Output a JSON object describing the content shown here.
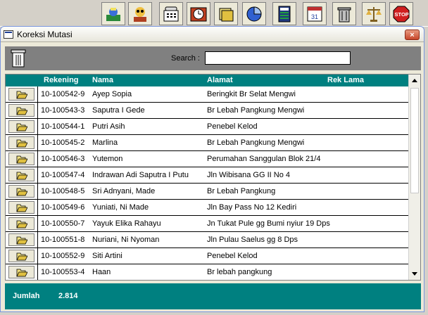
{
  "window": {
    "title": "Koreksi Mutasi",
    "close_label": "×"
  },
  "toolbar": {
    "icons": [
      "mail-icon",
      "cashier-icon",
      "phone-icon",
      "clock-icon",
      "folders-icon",
      "pie-chart-icon",
      "calculator-icon",
      "calendar-icon",
      "trash-icon",
      "scale-icon",
      "stop-icon"
    ],
    "stop_label": "STOP"
  },
  "search": {
    "label": "Search :",
    "value": ""
  },
  "grid": {
    "columns": [
      "Rekening",
      "Nama",
      "Alamat",
      "Rek Lama"
    ],
    "rows": [
      {
        "rekening": "10-100542-9",
        "nama": "Ayep Sopia",
        "alamat": "Beringkit Br Selat Mengwi",
        "rek_lama": ""
      },
      {
        "rekening": "10-100543-3",
        "nama": "Saputra I Gede",
        "alamat": "Br Lebah Pangkung Mengwi",
        "rek_lama": ""
      },
      {
        "rekening": "10-100544-1",
        "nama": "Putri Asih",
        "alamat": "Penebel Kelod",
        "rek_lama": ""
      },
      {
        "rekening": "10-100545-2",
        "nama": "Marlina",
        "alamat": "Br Lebah Pangkung Mengwi",
        "rek_lama": ""
      },
      {
        "rekening": "10-100546-3",
        "nama": "Yutemon",
        "alamat": "Perumahan Sanggulan Blok 21/4",
        "rek_lama": ""
      },
      {
        "rekening": "10-100547-4",
        "nama": "Indrawan Adi Saputra I Putu",
        "alamat": "Jln Wibisana GG II No 4",
        "rek_lama": ""
      },
      {
        "rekening": "10-100548-5",
        "nama": "Sri Adnyani, Made",
        "alamat": "Br Lebah Pangkung",
        "rek_lama": ""
      },
      {
        "rekening": "10-100549-6",
        "nama": "Yuniati, Ni Made",
        "alamat": "Jln Bay Pass No 12 Kediri",
        "rek_lama": ""
      },
      {
        "rekening": "10-100550-7",
        "nama": "Yayuk Elika Rahayu",
        "alamat": "Jn Tukat Pule gg Bumi nyiur 19 Dps",
        "rek_lama": ""
      },
      {
        "rekening": "10-100551-8",
        "nama": "Nuriani, Ni Nyoman",
        "alamat": "Jln Pulau Saelus gg 8 Dps",
        "rek_lama": ""
      },
      {
        "rekening": "10-100552-9",
        "nama": "Siti Artini",
        "alamat": "Penebel Kelod",
        "rek_lama": ""
      },
      {
        "rekening": "10-100553-4",
        "nama": "Haan",
        "alamat": "Br lebah pangkung",
        "rek_lama": ""
      }
    ]
  },
  "footer": {
    "jumlah_label": "Jumlah",
    "jumlah_value": "2.814"
  },
  "colors": {
    "teal": "#008080",
    "gray_panel": "#808080"
  }
}
